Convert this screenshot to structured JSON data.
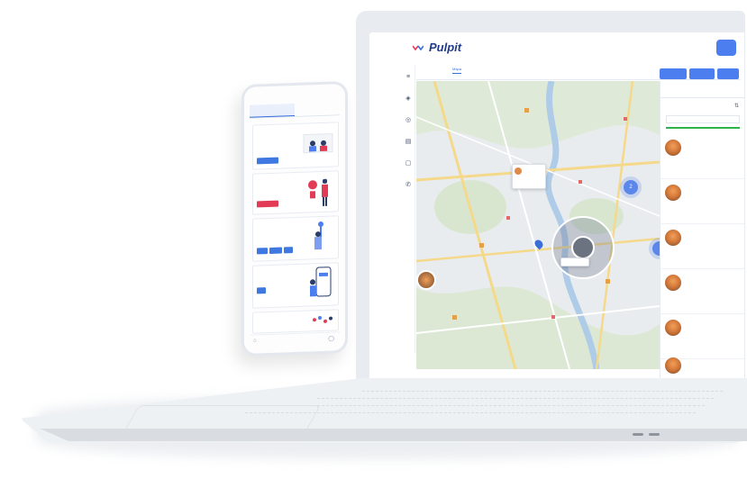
{
  "phone": {
    "tab_left": "",
    "tab_right": "",
    "cards": [
      {
        "title": "",
        "value": "",
        "button": ""
      },
      {
        "title": "",
        "value": "",
        "button": ""
      },
      {
        "title": "",
        "value": "",
        "buttons": [
          "",
          "",
          ""
        ]
      },
      {
        "title": "",
        "value": "",
        "button": ""
      },
      {
        "title": "",
        "value": ""
      }
    ]
  },
  "app": {
    "title": "Pulpit",
    "avatar": "",
    "subtabs": [
      "",
      "Mapa"
    ],
    "toolbar": [
      "",
      "",
      ""
    ],
    "right_panel": {
      "tabs": [
        "",
        ""
      ],
      "search_heading": "",
      "filter_value": "",
      "cards": [
        {
          "name": "",
          "line1": "",
          "line2": "",
          "link": ""
        },
        {
          "name": "",
          "line1": "",
          "line2": "",
          "link": ""
        },
        {
          "name": "",
          "line1": "",
          "line2": "",
          "link": ""
        },
        {
          "name": "",
          "line1": "",
          "line2": "",
          "link": ""
        },
        {
          "name": "",
          "line1": "",
          "line2": ""
        },
        {
          "name": "",
          "line1": "",
          "line2": ""
        }
      ]
    },
    "map": {
      "clusters": [
        "2",
        ""
      ],
      "popup_name": "",
      "circle_label": ""
    }
  },
  "colors": {
    "accent": "#4c7ef0",
    "brand_dark": "#203a8a",
    "progress": "#2db34a",
    "phone_alert": "#e23b55"
  }
}
